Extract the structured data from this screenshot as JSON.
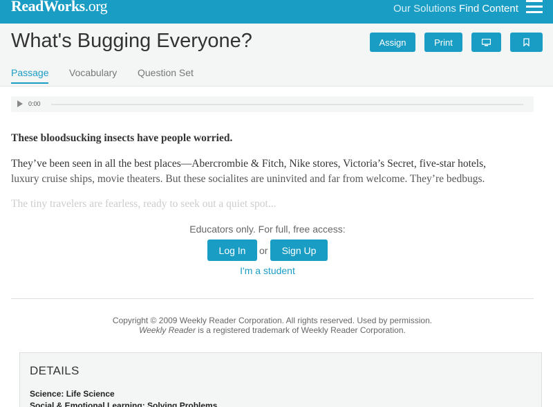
{
  "brand": {
    "logo_text": "ReadWorks",
    "logo_suffix": ".org"
  },
  "nav": {
    "solutions": "Our Solutions",
    "find_content": "Find Content"
  },
  "article": {
    "title": "What's Bugging Everyone?",
    "buttons": {
      "assign": "Assign",
      "print": "Print"
    },
    "tabs": [
      "Passage",
      "Vocabulary",
      "Question Set"
    ]
  },
  "audio": {
    "time": "0:00",
    "progress": 0
  },
  "passage": {
    "lead": "These bloodsucking insects have people worried.",
    "para1_line1": "They’ve been seen in all the best places—Abercrombie & Fitch, Nike stores, Victoria’s Secret, five-star hotels,",
    "para1_line2": "luxury cruise ships, movie theaters. But these socialites are uninvited and far from welcome. They’re bedbugs.",
    "para2": "The tiny travelers are fearless, ready to seek out a quiet spot..."
  },
  "gate": {
    "prompt": "Educators only. For full, free access:",
    "login": "Log In",
    "or": "or",
    "signup": "Sign Up",
    "student": "I'm a student"
  },
  "copyright": {
    "line1": "Copyright © 2009 Weekly Reader Corporation. All rights reserved. Used by permission.",
    "line2_em": "Weekly Reader",
    "line2_rest": " is a registered trademark of Weekly Reader Corporation."
  },
  "details": {
    "title": "DETAILS",
    "items": [
      "Science: Life Science",
      "Social & Emotional Learning: Solving Problems"
    ]
  },
  "colors": {
    "brand": "#1a9dc4",
    "header_bg": "#f4f5f5"
  },
  "icons": {
    "menu": "hamburger-menu-icon",
    "present": "monitor-icon",
    "bookmark": "bookmark-icon",
    "play": "play-icon"
  }
}
